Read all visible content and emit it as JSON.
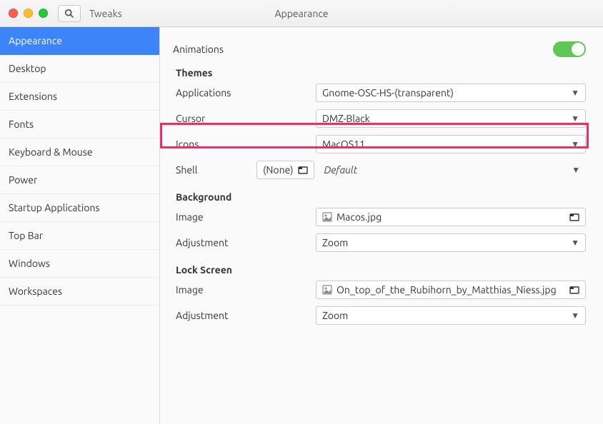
{
  "header": {
    "app_name": "Tweaks",
    "window_title": "Appearance"
  },
  "sidebar": {
    "items": [
      {
        "label": "Appearance",
        "active": true
      },
      {
        "label": "Desktop"
      },
      {
        "label": "Extensions"
      },
      {
        "label": "Fonts"
      },
      {
        "label": "Keyboard & Mouse"
      },
      {
        "label": "Power"
      },
      {
        "label": "Startup Applications"
      },
      {
        "label": "Top Bar"
      },
      {
        "label": "Windows"
      },
      {
        "label": "Workspaces"
      }
    ]
  },
  "content": {
    "animations_label": "Animations",
    "animations_on": true,
    "themes": {
      "title": "Themes",
      "applications": {
        "label": "Applications",
        "value": "Gnome-OSC-HS-(transparent)"
      },
      "cursor": {
        "label": "Cursor",
        "value": "DMZ-Black"
      },
      "icons": {
        "label": "Icons",
        "value": "MacOS11"
      },
      "shell": {
        "label": "Shell",
        "none": "(None)",
        "value": "Default"
      }
    },
    "background": {
      "title": "Background",
      "image": {
        "label": "Image",
        "value": "Macos.jpg"
      },
      "adjustment": {
        "label": "Adjustment",
        "value": "Zoom"
      }
    },
    "lockscreen": {
      "title": "Lock Screen",
      "image": {
        "label": "Image",
        "value": "On_top_of_the_Rubihorn_by_Matthias_Niess.jpg"
      },
      "adjustment": {
        "label": "Adjustment",
        "value": "Zoom"
      }
    }
  }
}
